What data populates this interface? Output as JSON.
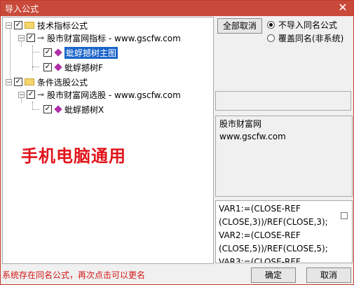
{
  "window": {
    "title": "导入公式",
    "close_glyph": "✕"
  },
  "tree": [
    {
      "label": "技术指标公式",
      "toggle": "−",
      "checked": true,
      "kind": "folder"
    },
    {
      "label": "股市财富网指标 - www.gscfw.com",
      "toggle": "−",
      "checked": true,
      "kind": "key"
    },
    {
      "label": "蚍蜉撼树主图",
      "checked": true,
      "kind": "formula",
      "selected": true
    },
    {
      "label": "蚍蜉撼树F",
      "checked": true,
      "kind": "formula"
    },
    {
      "label": "条件选股公式",
      "toggle": "−",
      "checked": true,
      "kind": "folder"
    },
    {
      "label": "股市财富网选股 - www.gscfw.com",
      "toggle": "−",
      "checked": true,
      "kind": "key"
    },
    {
      "label": "蚍蜉撼树X",
      "checked": true,
      "kind": "formula"
    }
  ],
  "overlay_text": "手机电脑通用",
  "buttons": {
    "cancel_all": "全部取消",
    "ok": "确定",
    "cancel": "取消"
  },
  "options": {
    "no_import": "不导入同名公式",
    "overwrite": "覆盖同名(非系统)",
    "selected": "no_import"
  },
  "info": {
    "line1": "股市财富网",
    "line2": "www.gscfw.com"
  },
  "code_lines": [
    "VAR1:=(CLOSE-REF",
    "(CLOSE,3))/REF(CLOSE,3);",
    "VAR2:=(CLOSE-REF",
    "(CLOSE,5))/REF(CLOSE,5);",
    "VAR3:=(CLOSE-REF"
  ],
  "status_text": "系统存在同名公式，再次点击可以更名",
  "icons": {
    "checkbox_mark": "✓"
  },
  "colors": {
    "titlebar": "#c94a3a",
    "selection": "#1a64c8",
    "watermark": "#e0141b",
    "status": "#d41818"
  }
}
